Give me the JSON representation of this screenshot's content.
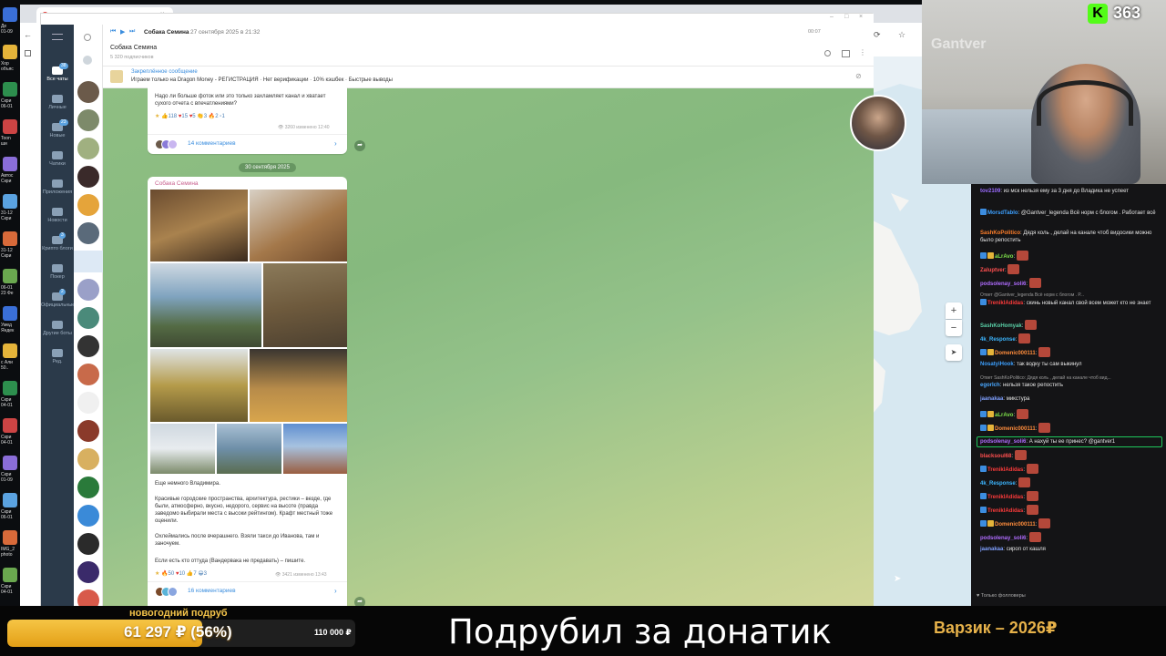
{
  "desktop": {
    "labels": [
      "Де",
      "01-09",
      "Хор",
      "объяс",
      "Скри",
      "06-01",
      "Toon",
      "ши",
      "Автос",
      "Скри",
      "31-12",
      "Скри",
      "31-12",
      "Скри",
      "06-01",
      "23 Фе",
      "Умед",
      "Яндек",
      "с Али",
      "50..",
      "Скри",
      "04-01",
      "Скри",
      "04-01",
      "Скри",
      "01-09",
      "Скри",
      "06-01",
      "IMG_2",
      "photo",
      "Скри",
      "04-01"
    ]
  },
  "browser": {
    "tab_close": "×"
  },
  "telegram": {
    "titlebar": {
      "controls": [
        "–",
        "□",
        "×"
      ]
    },
    "folders": [
      {
        "label": "Все чаты",
        "badge": "38",
        "active": true
      },
      {
        "label": "Личные",
        "badge": "",
        "active": false
      },
      {
        "label": "Новые",
        "badge": "23",
        "active": false
      },
      {
        "label": "Чатики",
        "badge": "",
        "active": false
      },
      {
        "label": "Приложения",
        "badge": "",
        "active": false
      },
      {
        "label": "Новости",
        "badge": "",
        "active": false
      },
      {
        "label": "Крипто блоги",
        "badge": "3",
        "active": false
      },
      {
        "label": "Покер",
        "badge": "",
        "active": false
      },
      {
        "label": "Официальные",
        "badge": "2",
        "active": false
      },
      {
        "label": "Другие боты",
        "badge": "",
        "active": false
      },
      {
        "label": "Ред.",
        "badge": "",
        "active": false
      }
    ],
    "player": {
      "title": "Собака Семина",
      "date": "27 сентября 2025 в 21:32",
      "time": "00:07"
    },
    "channel": {
      "name": "Собака Семина",
      "subscribers": "5 320 подписчиков"
    },
    "pinned": {
      "label": "Закреплённое сообщение",
      "text": "Играем только на Dragon Money - РЕГИСТРАЦИЯ · Нет верификации · 10% кэшбек · Быстрые выводы"
    },
    "post1": {
      "text": "Надо ли больше фоток или это только захламляет канал и хватает сухого отчета с впечатлениями?",
      "reactions": [
        "118",
        "15",
        "5",
        "3",
        "2",
        "1"
      ],
      "views": "3260",
      "edited": "изменено 12:40",
      "comments": "14 комментариев"
    },
    "date_separator": "30 сентября 2025",
    "post2": {
      "author": "Собака Семина",
      "paragraphs": [
        "Еще немного Владимира.",
        "Красивые городские пространства, архитектура, рестики – везде, где были, атмосферно, вкусно, недорого, сервис на высоте (правда заведомо выбирали места с высоки рейтингом). Крафт местный тоже оценили.",
        "Охлеймались после вчерашнего. Взяли такси до Иванова, там и заночуем.",
        "Если есть кто оттуда (Вандервака не предавать) – пишите."
      ],
      "reactions": [
        "50",
        "10",
        "7",
        "3"
      ],
      "views": "3421",
      "edited": "изменено 13:43",
      "comments": "16 комментариев"
    }
  },
  "map": {
    "zoom_in": "+",
    "zoom_out": "−",
    "locate": "➤"
  },
  "twitch_chat": {
    "messages": [
      {
        "user": "tov2109",
        "color": "#9b6bff",
        "text": "из мск нельзя ему за 3 дня до Владика не успеет",
        "emote": false,
        "badges": 0,
        "sys": ""
      },
      {
        "user": "MorsdTablo",
        "color": "#3ca0ff",
        "text": "@Gantver_legenda Всё норм с блогом . Работает всё",
        "emote": false,
        "badges": 1,
        "sys": ""
      },
      {
        "user": "SashKoPolitico",
        "color": "#ff7f2a",
        "text": "Дядя коль , делай на канале чтоб видосики можно было репостить",
        "emote": false,
        "badges": 0,
        "sys": ""
      },
      {
        "user": "aLrAvo",
        "color": "#7de04a",
        "text": "",
        "emote": true,
        "badges": 2,
        "sys": ""
      },
      {
        "user": "Zaluptver",
        "color": "#ff4f4f",
        "text": "",
        "emote": true,
        "badges": 0,
        "sys": ""
      },
      {
        "user": "podsolenay_soli6",
        "color": "#b06cff",
        "text": "",
        "emote": true,
        "badges": 0,
        "sys": ""
      },
      {
        "user": "TreniklAdidas",
        "color": "#ff3b3b",
        "text": "скинь новый канал свой всем может кто не знает",
        "emote": false,
        "badges": 1,
        "sys": "Ответ @Gantver_legenda Всё норм с блогом . Р..."
      },
      {
        "user": "SashKoHomyak",
        "color": "#5ad1a8",
        "text": "",
        "emote": true,
        "badges": 0,
        "sys": ""
      },
      {
        "user": "4k_Response",
        "color": "#3cb6ff",
        "text": "",
        "emote": true,
        "badges": 0,
        "sys": ""
      },
      {
        "user": "Domenic000111",
        "color": "#ff8d3c",
        "text": "",
        "emote": true,
        "badges": 2,
        "sys": ""
      },
      {
        "user": "NosatyiHook",
        "color": "#3ca0ff",
        "text": "так водку ты сам выкинул",
        "emote": false,
        "badges": 0,
        "sys": ""
      },
      {
        "user": "egorIch",
        "color": "#4aa8ff",
        "text": "нельзя такое репостить",
        "emote": false,
        "badges": 0,
        "sys": "Ответ SashKoPolitico: Дядя коль , делай на канале чтоб вид..."
      },
      {
        "user": "jaanakaa",
        "color": "#7fa0ff",
        "text": "микстура",
        "emote": false,
        "badges": 0,
        "sys": ""
      },
      {
        "user": "aLrAvo",
        "color": "#7de04a",
        "text": "",
        "emote": true,
        "badges": 2,
        "sys": ""
      },
      {
        "user": "Domenic000111",
        "color": "#ff8d3c",
        "text": "",
        "emote": true,
        "badges": 2,
        "sys": ""
      },
      {
        "user": "podsolenay_soli6",
        "color": "#b06cff",
        "text": "А нахуй ты ее принес? @gantver1",
        "emote": false,
        "badges": 0,
        "sys": ""
      },
      {
        "user": "blacksoul68",
        "color": "#ff4f4f",
        "text": "",
        "emote": true,
        "badges": 0,
        "sys": ""
      },
      {
        "user": "TreniklAdidas",
        "color": "#ff3b3b",
        "text": "",
        "emote": true,
        "badges": 1,
        "sys": ""
      },
      {
        "user": "4k_Response",
        "color": "#3cb6ff",
        "text": "",
        "emote": true,
        "badges": 0,
        "sys": ""
      },
      {
        "user": "TreniklAdidas",
        "color": "#ff3b3b",
        "text": "",
        "emote": true,
        "badges": 1,
        "sys": ""
      },
      {
        "user": "TreniklAdidas",
        "color": "#ff3b3b",
        "text": "",
        "emote": true,
        "badges": 1,
        "sys": ""
      },
      {
        "user": "Domenic000111",
        "color": "#ff8d3c",
        "text": "",
        "emote": true,
        "badges": 2,
        "sys": ""
      },
      {
        "user": "podsolenay_soli6",
        "color": "#b06cff",
        "text": "",
        "emote": true,
        "badges": 0,
        "sys": ""
      },
      {
        "user": "jaanakaa",
        "color": "#7fa0ff",
        "text": "сироп от кашля",
        "emote": false,
        "badges": 0,
        "sys": ""
      }
    ],
    "followers_only": "Только фолловеры"
  },
  "overlay": {
    "counter": "363",
    "goal_title": "новогодний подруб",
    "goal_amount": "61 297 ₽ (56%)",
    "goal_fraction": 0.56,
    "goal_target": "110 000 ₽",
    "headline": "Подрубил за донатик",
    "side_text": "Варзик – 2026₽",
    "webcam_wall": "Gantver"
  },
  "colors": {
    "accent_gold": "#e5b43a",
    "twitch_green": "#1fc85c",
    "telegram_blue": "#3a8dde"
  }
}
